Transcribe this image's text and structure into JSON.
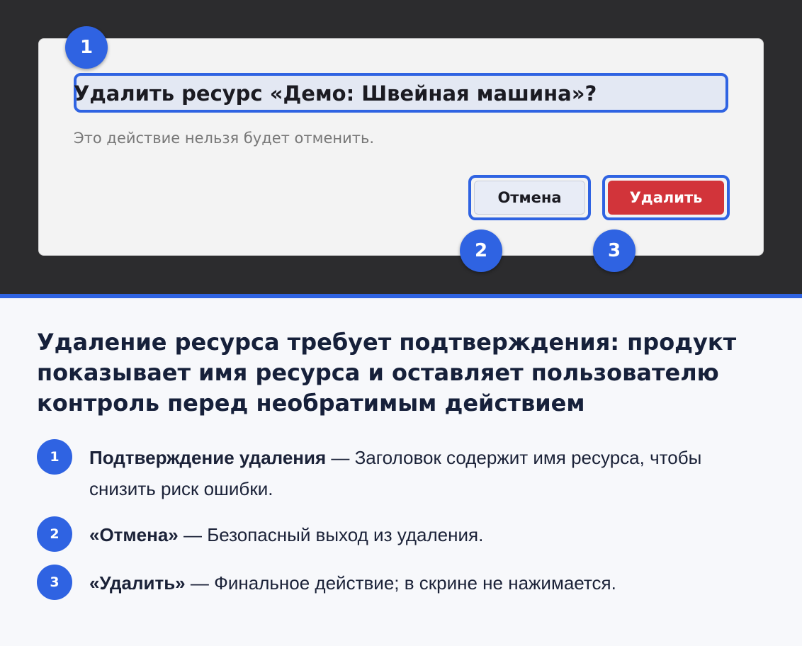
{
  "dialog": {
    "title": "Удалить ресурс «Демо: Швейная машина»?",
    "message": "Это действие нельзя будет отменить.",
    "cancel_label": "Отмена",
    "delete_label": "Удалить"
  },
  "markers": [
    "1",
    "2",
    "3"
  ],
  "explanation": {
    "heading": "Удаление ресурса требует подтверждения: продукт показывает имя ресурса и оставляет пользователю контроль перед необратимым действием",
    "items": [
      {
        "number": "1",
        "term": "Подтверждение удаления",
        "separator": " — ",
        "description": "Заголовок содержит имя ресурса, чтобы снизить риск ошибки."
      },
      {
        "number": "2",
        "term": "«Отмена»",
        "separator": " — ",
        "description": "Безопасный выход из удаления."
      },
      {
        "number": "3",
        "term": "«Удалить»",
        "separator": " — ",
        "description": "Финальное действие; в скрине не нажимается."
      }
    ]
  },
  "colors": {
    "accent": "#2f63e2",
    "danger": "#d2343a",
    "backdrop": "#2c2c2e"
  }
}
